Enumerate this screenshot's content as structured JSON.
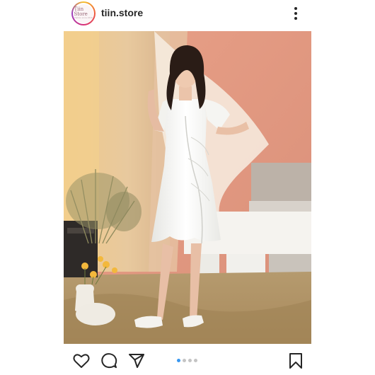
{
  "post": {
    "username": "tiin.store",
    "avatar_text_main": "Tiin Store",
    "avatar_text_sub": "fashion since 2010",
    "carousel": {
      "count": 4,
      "active_index": 0,
      "active_color": "#3897f0",
      "inactive_color": "#c4c4c4"
    }
  },
  "icons": {
    "more": "more-vertical-icon",
    "like": "heart-icon",
    "comment": "comment-bubble-icon",
    "share": "paper-plane-icon",
    "save": "bookmark-icon"
  }
}
